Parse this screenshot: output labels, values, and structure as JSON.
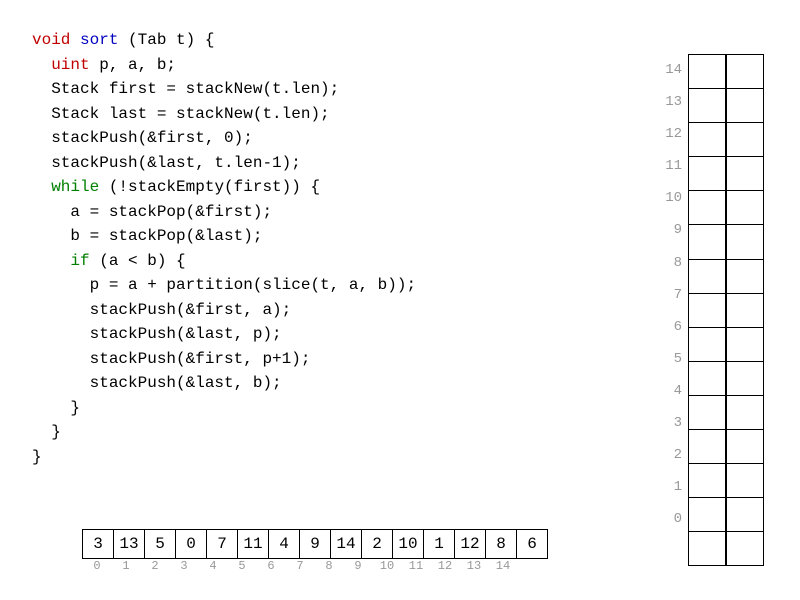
{
  "code": {
    "tokens": [
      {
        "t": "void",
        "c": "kw-type"
      },
      {
        "t": " "
      },
      {
        "t": "sort",
        "c": "kw-func"
      },
      {
        "t": " (Tab t) {\n"
      },
      {
        "t": "  "
      },
      {
        "t": "uint",
        "c": "kw-type"
      },
      {
        "t": " p, a, b;\n"
      },
      {
        "t": "  Stack first = stackNew(t.len);\n"
      },
      {
        "t": "  Stack last = stackNew(t.len);\n"
      },
      {
        "t": "  stackPush(&first, 0);\n"
      },
      {
        "t": "  stackPush(&last, t.len-1);\n"
      },
      {
        "t": "  "
      },
      {
        "t": "while",
        "c": "kw-ctrl"
      },
      {
        "t": " (!stackEmpty(first)) {\n"
      },
      {
        "t": "    a = stackPop(&first);\n"
      },
      {
        "t": "    b = stackPop(&last);\n"
      },
      {
        "t": "    "
      },
      {
        "t": "if",
        "c": "kw-ctrl"
      },
      {
        "t": " (a < b) {\n"
      },
      {
        "t": "      p = a + partition(slice(t, a, b));\n"
      },
      {
        "t": "      stackPush(&first, a);\n"
      },
      {
        "t": "      stackPush(&last, p);\n"
      },
      {
        "t": "      stackPush(&first, p+1);\n"
      },
      {
        "t": "      stackPush(&last, b);\n"
      },
      {
        "t": "    }\n"
      },
      {
        "t": "  }\n"
      },
      {
        "t": "}"
      }
    ]
  },
  "harray": {
    "values": [
      3,
      13,
      5,
      0,
      7,
      11,
      4,
      9,
      14,
      2,
      10,
      1,
      12,
      8,
      6
    ],
    "indices": [
      0,
      1,
      2,
      3,
      4,
      5,
      6,
      7,
      8,
      9,
      10,
      11,
      12,
      13,
      14
    ]
  },
  "vstack": {
    "indices": [
      14,
      13,
      12,
      11,
      10,
      9,
      8,
      7,
      6,
      5,
      4,
      3,
      2,
      1,
      0
    ],
    "first": [
      "",
      "",
      "",
      "",
      "",
      "",
      "",
      "",
      "",
      "",
      "",
      "",
      "",
      "",
      ""
    ],
    "last": [
      "",
      "",
      "",
      "",
      "",
      "",
      "",
      "",
      "",
      "",
      "",
      "",
      "",
      "",
      ""
    ]
  }
}
